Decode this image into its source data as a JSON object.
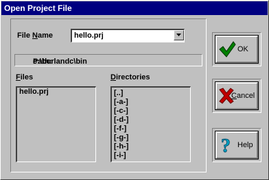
{
  "window": {
    "title": "Open Project File"
  },
  "form": {
    "file_name_label_pre": "File ",
    "file_name_label_ul": "N",
    "file_name_label_post": "ame",
    "file_name_value": "hello.prj",
    "path_label": "Path:",
    "path_value": "c:\\borlandc\\bin"
  },
  "files": {
    "label_ul": "F",
    "label_post": "iles",
    "items": [
      "hello.prj"
    ]
  },
  "directories": {
    "label_ul": "D",
    "label_post": "irectories",
    "items": [
      "[..]",
      "[-a-]",
      "[-c-]",
      "[-d-]",
      "[-f-]",
      "[-g-]",
      "[-h-]",
      "[-i-]"
    ]
  },
  "buttons": {
    "ok": {
      "label": "OK",
      "icon": "checkmark-icon",
      "color": "#008000"
    },
    "cancel": {
      "label_ul": "C",
      "label_post": "ancel",
      "icon": "cancel-x-icon",
      "color": "#c00000"
    },
    "help": {
      "label": "Help",
      "icon": "question-mark-icon",
      "color": "#00a0c0"
    }
  }
}
